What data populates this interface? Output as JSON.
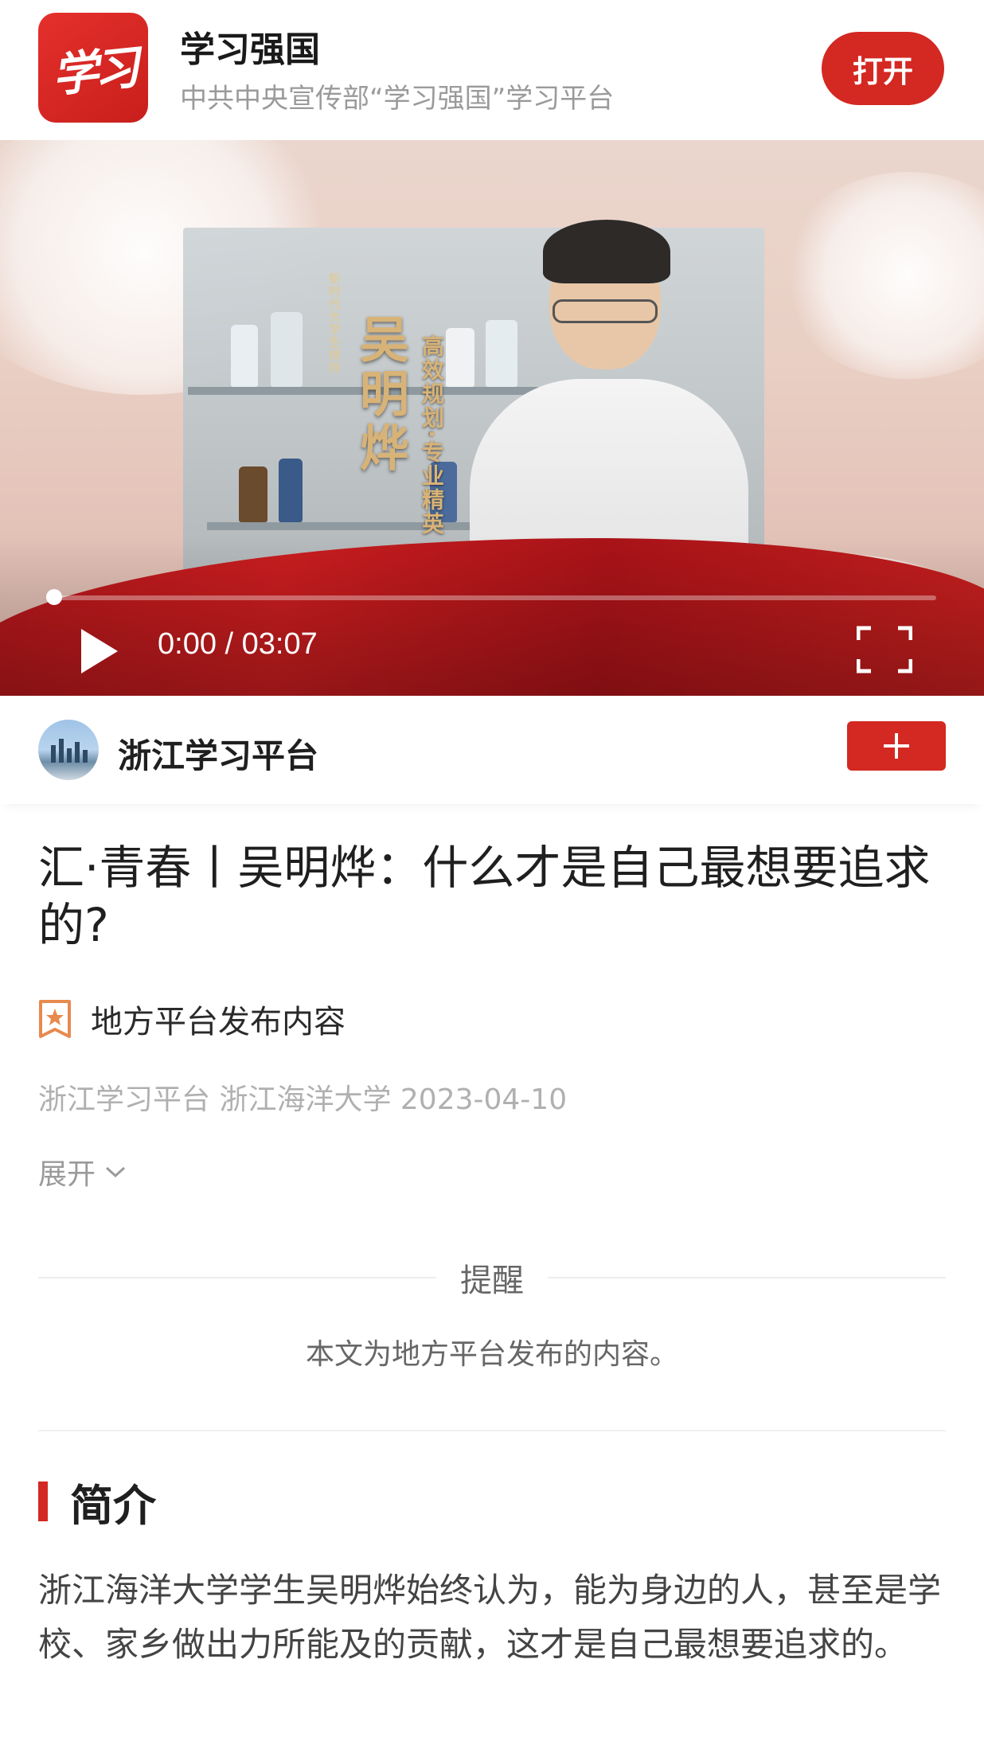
{
  "app_banner": {
    "logo_text": "学习",
    "name": "学习强国",
    "description": "中共中央宣传部“学习强国”学习平台",
    "open_button": "打开"
  },
  "video": {
    "overlay_title": "吴明烨",
    "overlay_subtitle": "高效规划·专业精英",
    "overlay_series": "新时代大学生榜样",
    "current_time": "0:00",
    "duration": "03:07",
    "time_display": "0:00 / 03:07",
    "progress": 0.0
  },
  "channel": {
    "name": "浙江学习平台",
    "follow_icon": "plus-icon"
  },
  "article": {
    "title": "汇·青春丨吴明烨：什么才是自己最想要追求的?",
    "source_tag": "地方平台发布内容",
    "meta": "浙江学习平台 浙江海洋大学  2023-04-10",
    "expand_label": "展开"
  },
  "notice": {
    "title": "提醒",
    "body": "本文为地方平台发布的内容。"
  },
  "intro": {
    "heading": "简介",
    "text": "浙江海洋大学学生吴明烨始终认为，能为身边的人，甚至是学校、家乡做出力所能及的贡献，这才是自己最想要追求的。"
  },
  "colors": {
    "brand_red": "#d42822",
    "muted_text": "#9a9a9a"
  }
}
